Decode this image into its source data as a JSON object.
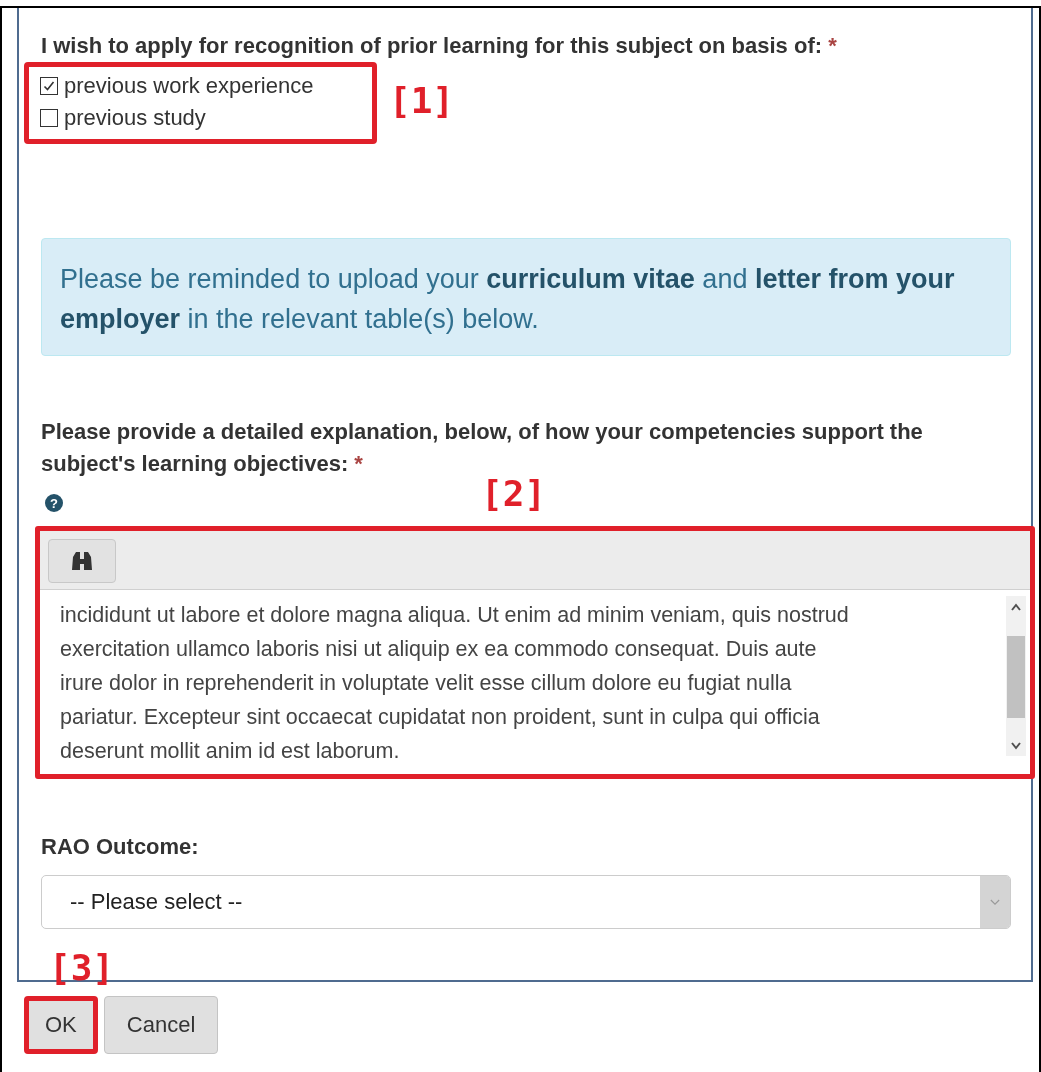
{
  "heading": {
    "text": "I wish to apply for recognition of prior learning for this subject on basis of:",
    "required": "*"
  },
  "options": [
    {
      "label": "previous work experience",
      "checked": true
    },
    {
      "label": "previous study",
      "checked": false
    }
  ],
  "notice": "Please be reminded to upload your **curriculum vitae** and **letter from your employer** in the relevant table(s) below.",
  "explanation": {
    "label": "Please provide a detailed explanation, below, of how your competencies support the subject's learning objectives:",
    "required": "*",
    "help": "?",
    "text": "incididunt ut labore et dolore magna aliqua. Ut enim ad minim veniam, quis nostrud\nexercitation ullamco laboris nisi ut aliquip ex ea commodo consequat. Duis aute\nirure dolor in reprehenderit in voluptate velit esse cillum dolore eu fugiat nulla\npariatur. Excepteur sint occaecat cupidatat non proident, sunt in culpa qui officia\ndeserunt mollit anim id est laborum."
  },
  "outcome": {
    "label": "RAO Outcome:",
    "placeholder": "-- Please select --"
  },
  "buttons": [
    {
      "label": "OK",
      "kind": "primary"
    },
    {
      "label": "Cancel",
      "kind": "secondary"
    }
  ],
  "annotations": [
    "[1]",
    "[2]",
    "[3]"
  ]
}
